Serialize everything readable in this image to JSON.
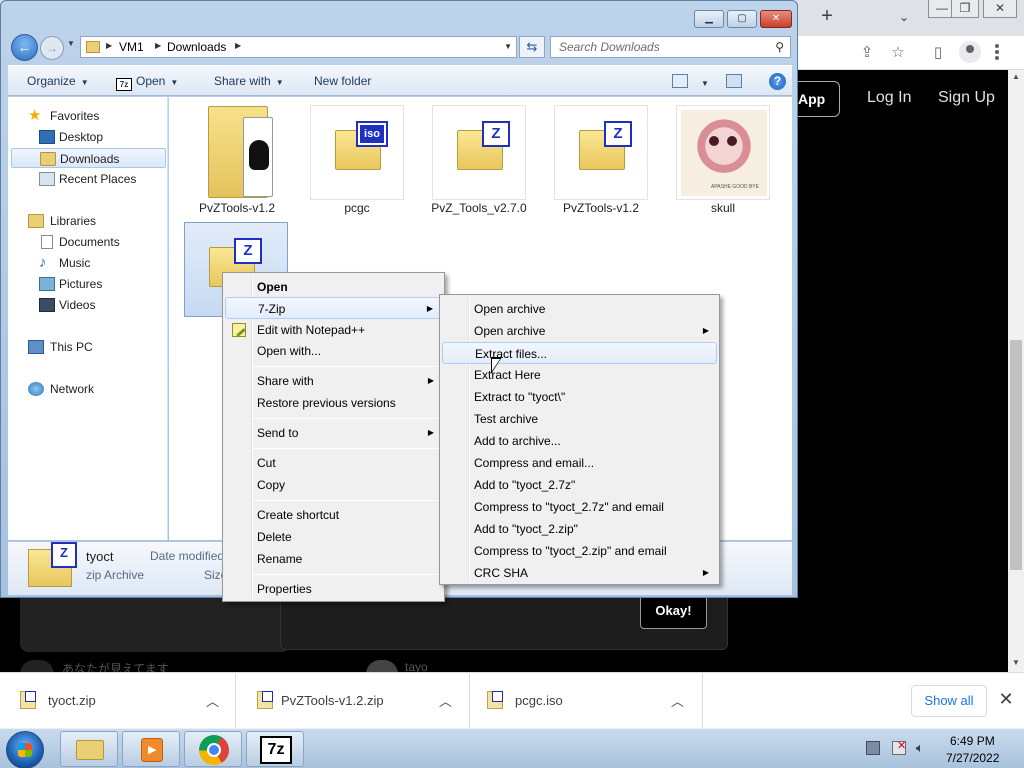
{
  "chrome": {
    "new_tab_symbol": "+",
    "tab_list_symbol": "⌄",
    "window_controls": [
      "—",
      "❐",
      "✕"
    ]
  },
  "web": {
    "app_button": "App",
    "login": "Log In",
    "signup": "Sign Up",
    "okay_button": "Okay!",
    "faded_text_left": "あなたが見えてます",
    "faded_text_right": "tayo"
  },
  "downloads_bar": {
    "items": [
      {
        "name": "tyoct.zip"
      },
      {
        "name": "PvZTools-v1.2.zip"
      },
      {
        "name": "pcgc.iso"
      }
    ],
    "show_all": "Show all",
    "close": "✕"
  },
  "taskbar": {
    "time": "6:49 PM",
    "date": "7/27/2022",
    "seven_zip_label": "7z"
  },
  "explorer": {
    "address": [
      "VM1",
      "Downloads"
    ],
    "search_placeholder": "Search Downloads",
    "commands": {
      "organize": "Organize",
      "open": "Open",
      "share_with": "Share with",
      "new_folder": "New folder"
    },
    "nav": {
      "favorites": "Favorites",
      "desktop": "Desktop",
      "downloads": "Downloads",
      "recent_places": "Recent Places",
      "libraries": "Libraries",
      "documents": "Documents",
      "music": "Music",
      "pictures": "Pictures",
      "videos": "Videos",
      "this_pc": "This PC",
      "network": "Network"
    },
    "files": [
      {
        "name": "PvZTools-v1.2",
        "type": "folder"
      },
      {
        "name": "pcgc",
        "type": "iso",
        "tag": "iso"
      },
      {
        "name": "PvZ_Tools_v2.7.0",
        "type": "archive",
        "tag": "Z"
      },
      {
        "name": "PvZTools-v1.2",
        "type": "archive",
        "tag": "Z"
      },
      {
        "name": "skull",
        "type": "image",
        "caption": "APASHE GOOD BYE"
      },
      {
        "name": "tyoct",
        "type": "archive",
        "tag": "Z",
        "selected": true
      }
    ],
    "details": {
      "name": "tyoct",
      "type": "zip Archive",
      "date_label": "Date modified",
      "size_label": "Size"
    }
  },
  "context_menu": {
    "items": {
      "open": "Open",
      "seven_zip": "7-Zip",
      "edit_notepad": "Edit with Notepad++",
      "open_with": "Open with...",
      "share_with": "Share with",
      "restore": "Restore previous versions",
      "send_to": "Send to",
      "cut": "Cut",
      "copy": "Copy",
      "create_shortcut": "Create shortcut",
      "delete": "Delete",
      "rename": "Rename",
      "properties": "Properties"
    }
  },
  "seven_zip_menu": {
    "items": [
      {
        "label": "Open archive",
        "submenu": false
      },
      {
        "label": "Open archive",
        "submenu": true
      },
      {
        "label": "Extract files...",
        "submenu": false,
        "highlighted": true
      },
      {
        "label": "Extract Here",
        "submenu": false
      },
      {
        "label": "Extract to \"tyoct\\\"",
        "submenu": false
      },
      {
        "label": "Test archive",
        "submenu": false
      },
      {
        "label": "Add to archive...",
        "submenu": false
      },
      {
        "label": "Compress and email...",
        "submenu": false
      },
      {
        "label": "Add to \"tyoct_2.7z\"",
        "submenu": false
      },
      {
        "label": "Compress to \"tyoct_2.7z\" and email",
        "submenu": false
      },
      {
        "label": "Add to \"tyoct_2.zip\"",
        "submenu": false
      },
      {
        "label": "Compress to \"tyoct_2.zip\" and email",
        "submenu": false
      },
      {
        "label": "CRC SHA",
        "submenu": true
      }
    ]
  }
}
